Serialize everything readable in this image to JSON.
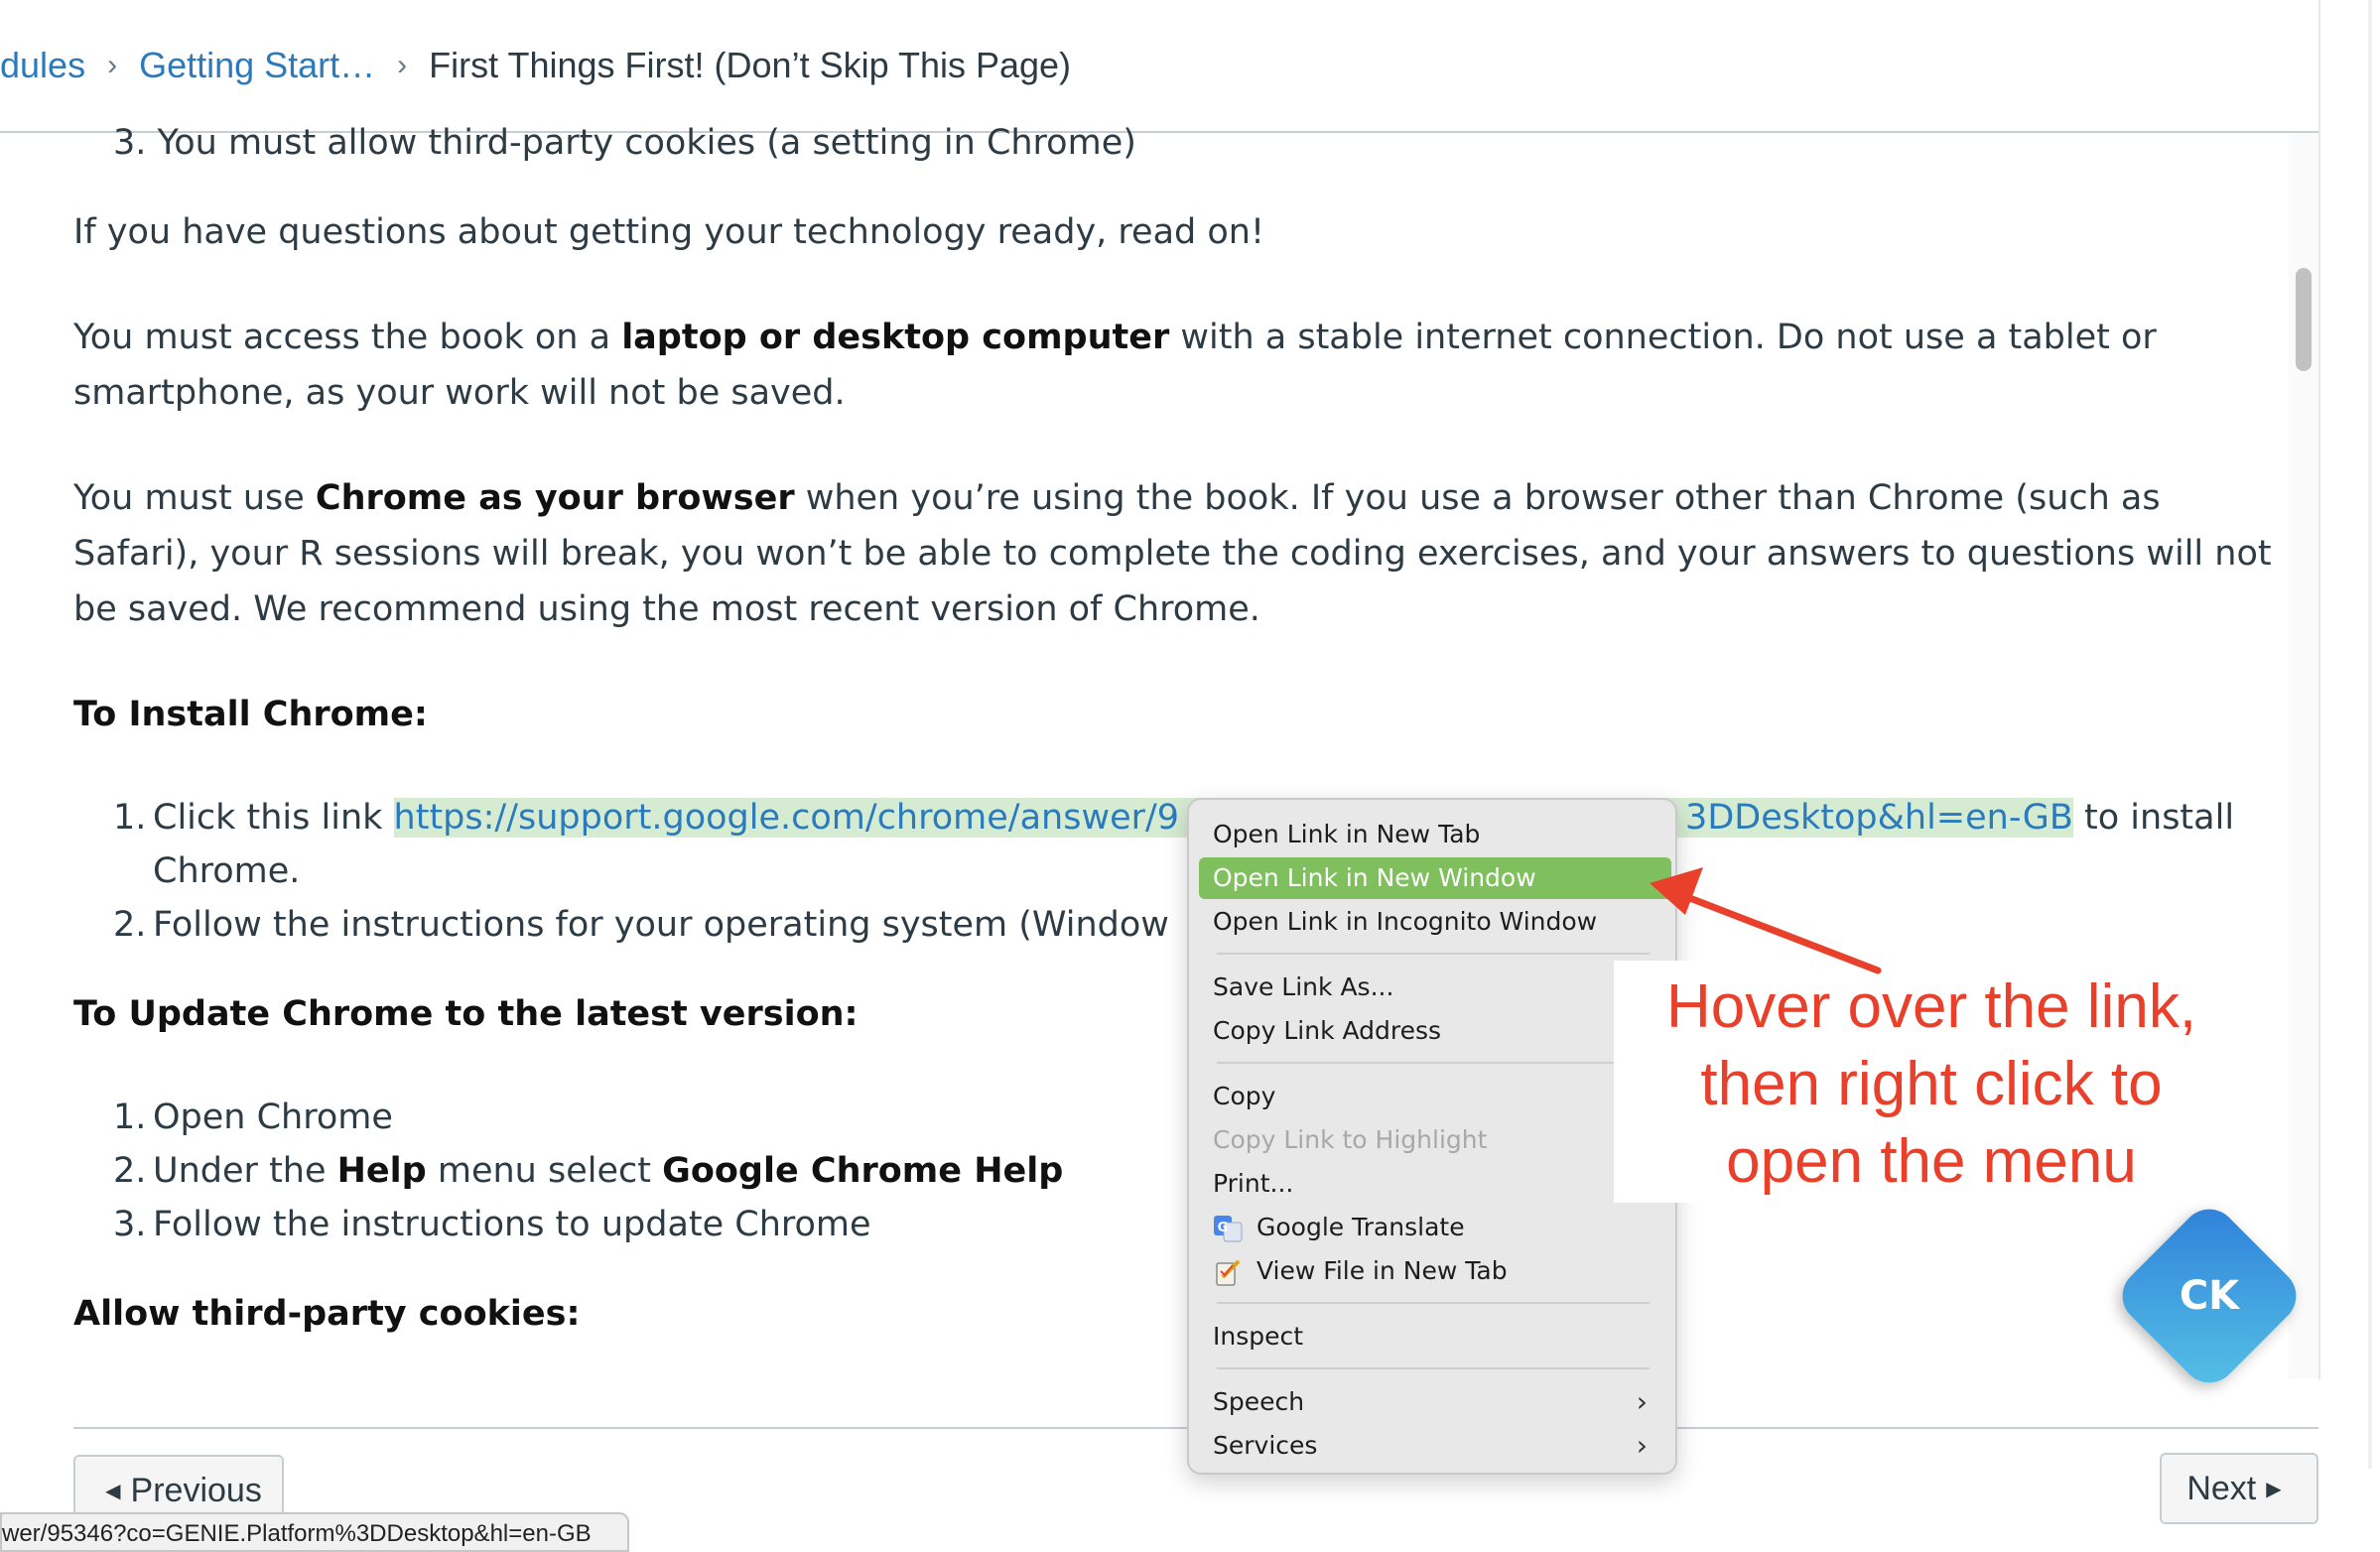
{
  "breadcrumb": {
    "items": [
      "dules",
      "Getting Start…"
    ],
    "separator": "›",
    "current": "First Things First! (Don’t Skip This Page)"
  },
  "content": {
    "top_partial": "3. You must allow third-party cookies (a setting in Chrome)",
    "p1": "If you have questions about getting your technology ready, read on!",
    "p2": {
      "pre": "You must access the book on a ",
      "bold": "laptop or desktop computer",
      "post": " with a stable internet connection. Do not use a tablet or",
      "line2": "smartphone, as your work will not be saved."
    },
    "p3": {
      "pre": "You must use ",
      "bold": "Chrome as your browser",
      "post": " when you’re using the book. If you use a browser other than Chrome (such as",
      "line2": "Safari), your R sessions will break, you won’t be able to complete the coding exercises, and your answers to questions will not",
      "line3": "be saved. We recommend using the most recent version of Chrome."
    },
    "install_heading": "To Install Chrome:",
    "install_1_pre": "Click this link ",
    "install_1_link_start": "https://support.google.com/chrome/answer/9",
    "install_1_link_end": "3DDesktop&hl=en-GB",
    "install_1_post": " to install",
    "install_1_line2": "Chrome.",
    "install_2": "Follow the instructions for your operating system (Window",
    "update_heading": "To Update Chrome to the latest version:",
    "update_1": "Open Chrome",
    "update_2_pre": "Under the ",
    "update_2_bold1": "Help",
    "update_2_mid": " menu select ",
    "update_2_bold2": "Google Chrome Help",
    "update_3": "Follow the instructions to update Chrome",
    "cookies_heading": "Allow third-party cookies:",
    "nums": [
      "1.",
      "2.",
      "3."
    ]
  },
  "nav": {
    "previous": "Previous",
    "next": "Next"
  },
  "status_url": "wer/95346?co=GENIE.Platform%3DDesktop&hl=en-GB",
  "context_menu": {
    "items": [
      "Open Link in New Tab",
      "Open Link in New Window",
      "Open Link in Incognito Window",
      "Save Link As...",
      "Copy Link Address",
      "Copy",
      "Copy Link to Highlight",
      "Print...",
      "Google Translate",
      "View File in New Tab",
      "Inspect",
      "Speech",
      "Services"
    ],
    "icons": [
      "google-translate-icon",
      "view-file-icon"
    ],
    "active_color": "#7fbf5e"
  },
  "annotation": {
    "lines": [
      "Hover over the link,",
      "then right click to",
      "open the menu"
    ],
    "color": "#e8402b"
  },
  "badge": {
    "label": "CK"
  },
  "colors": {
    "link": "#2b7abc",
    "link_highlight": "#d6ecd2"
  }
}
